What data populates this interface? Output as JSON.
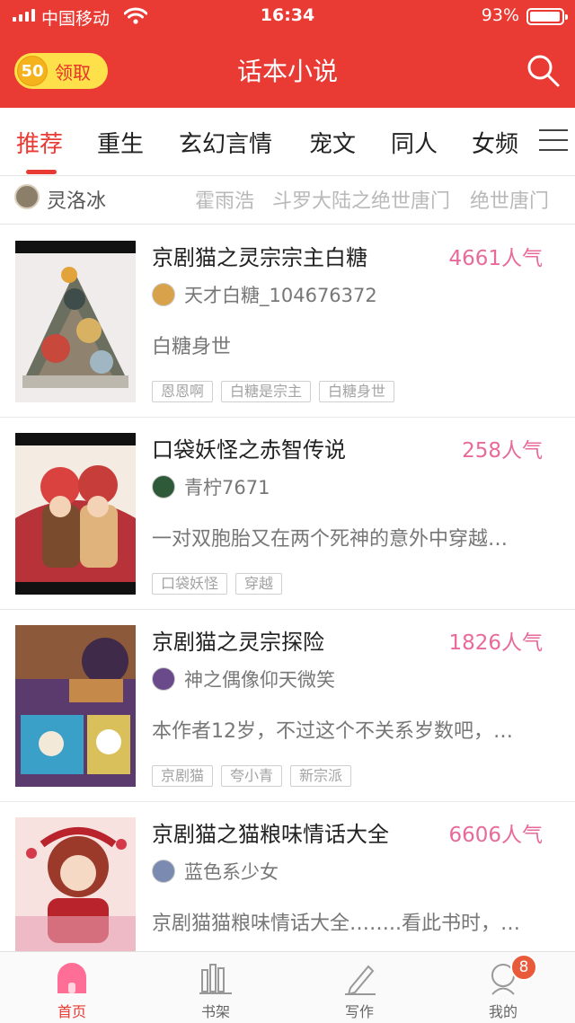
{
  "status_bar": {
    "carrier": "中国移动",
    "time": "16:34",
    "battery": "93%",
    "battery_level": 0.93
  },
  "header": {
    "reward_points": "50",
    "reward_label": "领取",
    "title": "话本小说",
    "search_icon": "search-icon"
  },
  "tabs": [
    {
      "label": "推荐",
      "active": true
    },
    {
      "label": "重生"
    },
    {
      "label": "玄幻言情"
    },
    {
      "label": "宠文"
    },
    {
      "label": "同人"
    },
    {
      "label": "女频"
    }
  ],
  "author_strip": {
    "current": "灵洛冰",
    "links": [
      "霍雨浩",
      "斗罗大陆之绝世唐门",
      "绝世唐门"
    ]
  },
  "books": [
    {
      "title": "京剧猫之灵宗宗主白糖",
      "popularity": "4661人气",
      "author": "天才白糖_104676372",
      "description": "白糖身世",
      "tags": [
        "恩恩啊",
        "白糖是宗主",
        "白糖身世"
      ],
      "cover_colors": [
        "#efeceb",
        "#6b6f5f",
        "#c8483c"
      ]
    },
    {
      "title": "口袋妖怪之赤智传说",
      "popularity": "258人气",
      "author": "青柠7671",
      "description": "一对双胞胎又在两个死神的意外中穿越…",
      "tags": [
        "口袋妖怪",
        "穿越"
      ],
      "cover_colors": [
        "#f4ebe3",
        "#b8323a",
        "#7a4b2d"
      ]
    },
    {
      "title": "京剧猫之灵宗探险",
      "popularity": "1826人气",
      "author": "神之偶像仰天微笑",
      "description": "本作者12岁，不过这个不关系岁数吧，…",
      "tags": [
        "京剧猫",
        "夸小青",
        "新宗派"
      ],
      "cover_colors": [
        "#5b3a6e",
        "#3aa0c8",
        "#d9c05a"
      ]
    },
    {
      "title": "京剧猫之猫粮味情话大全",
      "popularity": "6606人气",
      "author": "蓝色系少女",
      "description": "京剧猫猫粮味情话大全……..看此书时，…",
      "tags": [],
      "cover_colors": [
        "#f7e2e0",
        "#b8232c",
        "#e7a0b4"
      ]
    }
  ],
  "bottom_nav": [
    {
      "label": "首页",
      "icon": "home-icon",
      "active": true
    },
    {
      "label": "书架",
      "icon": "bookshelf-icon"
    },
    {
      "label": "写作",
      "icon": "pen-icon"
    },
    {
      "label": "我的",
      "icon": "profile-icon",
      "badge": "8"
    }
  ],
  "colors": {
    "brand": "#e93a33",
    "popularity": "#e86a9a",
    "reward": "#fde04a"
  }
}
